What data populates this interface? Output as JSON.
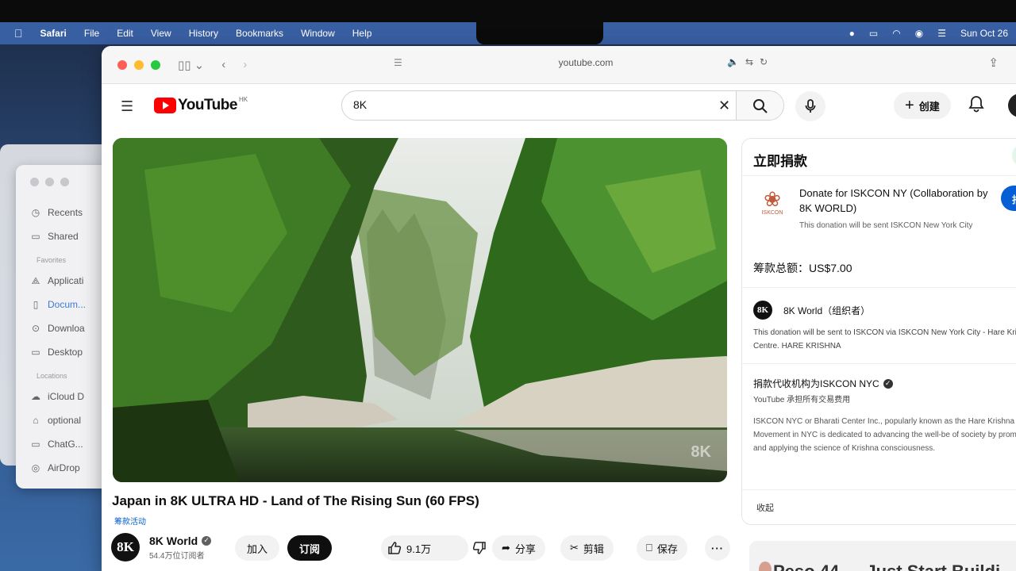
{
  "menubar": {
    "app": "Safari",
    "menus": [
      "File",
      "Edit",
      "View",
      "History",
      "Bookmarks",
      "Window",
      "Help"
    ],
    "datetime": "Sun Oct 26"
  },
  "finder": {
    "items_top": [
      "Recents",
      "Shared"
    ],
    "favorites_label": "Favorites",
    "favorites": [
      "Applicati",
      "Docum...",
      "Downloa",
      "Desktop"
    ],
    "locations_label": "Locations",
    "locations": [
      "iCloud D",
      "optional",
      "ChatG...",
      "AirDrop"
    ]
  },
  "safari": {
    "url": "youtube.com"
  },
  "youtube": {
    "logo_text": "YouTube",
    "region": "HK",
    "search_value": "8K",
    "create_label": "创建"
  },
  "video": {
    "watermark": "8K",
    "title": "Japan in 8K ULTRA HD - Land of The Rising Sun (60 FPS)",
    "fundraiser_tag": "筹款活动",
    "channel_avatar": "8K",
    "channel_name": "8K World",
    "subscribers": "54.4万位订阅者",
    "join_label": "加入",
    "subscribe_label": "订阅",
    "likes": "9.1万",
    "share_label": "分享",
    "clip_label": "剪辑",
    "save_label": "保存",
    "more_label": "···"
  },
  "donation": {
    "header": "立即捐款",
    "title": "Donate for ISKCON NY (Collaboration by 8K WORLD)",
    "note": "This donation will be sent ISKCON New York City",
    "button": "捐款",
    "logo_name": "ISKCON",
    "total": "筹款总额：US$7.00",
    "organizer_avatar": "8K",
    "organizer": "8K World（组织者）",
    "organizer_text": "This donation will be sent to ISKCON via ISKCON New York City - Hare Krishna Centre. HARE KRISHNA",
    "agent": "捐款代收机构为ISKCON NYC",
    "agent_sub": "YouTube 承担所有交易费用",
    "description": "ISKCON NYC or Bharati Center Inc., popularly known as the Hare Krishna Movement in NYC is dedicated to advancing the well-be of society by promoting and applying the science of Krishna consciousness.",
    "collapse": "收起"
  },
  "next_card_text": "Peso 44 — Just Start Buildi"
}
